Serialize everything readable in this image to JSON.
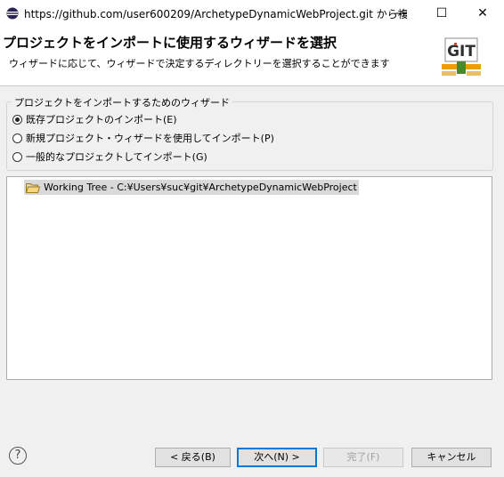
{
  "window": {
    "title": "https://github.com/user600209/ArchetypeDynamicWebProject.git から複...",
    "minimize_glyph": "—",
    "maximize_glyph": "☐",
    "close_glyph": "✕"
  },
  "header": {
    "title": "プロジェクトをインポートに使用するウィザードを選択",
    "description": "ウィザードに応じて、ウィザードで決定するディレクトリーを選択することができます",
    "logo_text": "GIT"
  },
  "wizard_group": {
    "legend": "プロジェクトをインポートするためのウィザード",
    "options": [
      {
        "label": "既存プロジェクトのインポート(E)",
        "checked": true
      },
      {
        "label": "新規プロジェクト・ウィザードを使用してインポート(P)",
        "checked": false
      },
      {
        "label": "一般的なプロジェクトしてインポート(G)",
        "checked": false
      }
    ]
  },
  "tree": {
    "items": [
      {
        "label": "Working Tree - C:¥Users¥suc¥git¥ArchetypeDynamicWebProject",
        "icon": "folder-open-icon",
        "selected": true
      }
    ]
  },
  "buttons": {
    "help": "?",
    "back": "< 戻る(B)",
    "next": "次へ(N) >",
    "finish": "完了(F)",
    "cancel": "キャンセル"
  },
  "colors": {
    "accent": "#0078d7",
    "selection": "#d9d9d9",
    "git_logo_red": "#e8401c",
    "git_logo_green": "#4a8a2a"
  }
}
